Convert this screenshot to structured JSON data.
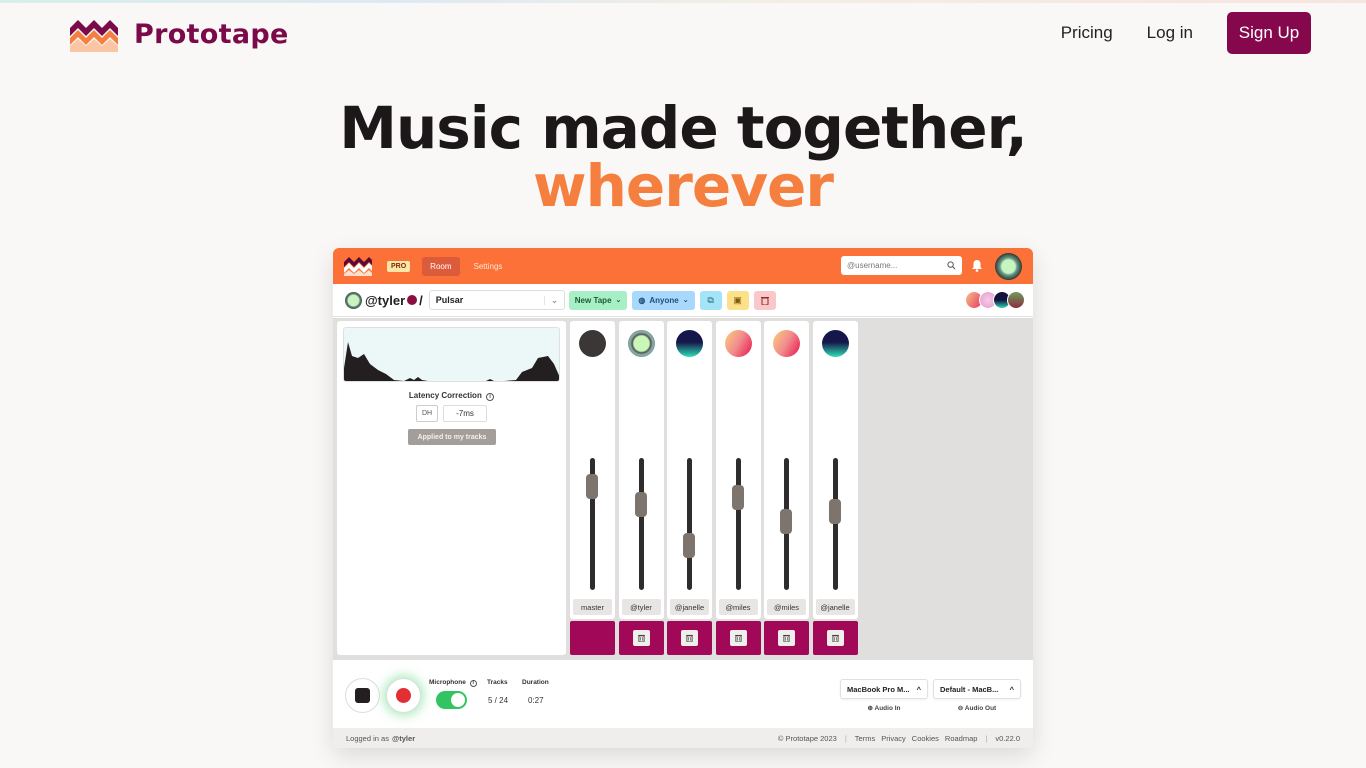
{
  "header": {
    "brand_name": "Prototape",
    "nav": {
      "pricing": "Pricing",
      "login": "Log in",
      "signup": "Sign Up"
    },
    "colors": {
      "brand": "#7a0a4a",
      "signup_bg": "#85084c",
      "accent": "#f57f3f"
    }
  },
  "hero": {
    "line1": "Music made together,",
    "line2": "wherever"
  },
  "app": {
    "topbar": {
      "badge": "PRO",
      "tabs": [
        {
          "label": "Room",
          "active": true
        },
        {
          "label": "Settings",
          "active": false
        }
      ],
      "search_placeholder": "@username...",
      "search_icon": "search-icon",
      "bell_icon": "bell-icon"
    },
    "toolbar": {
      "user": "@tyler",
      "separator": "/",
      "tape_name": "Pulsar",
      "new_tape": "New Tape",
      "visibility": "Anyone",
      "icons": [
        "copy-icon",
        "folder-play-icon",
        "trash-icon"
      ]
    },
    "latency": {
      "label": "Latency Correction",
      "skip_label": "DH",
      "value": "-7ms",
      "applied_label": "Applied to my tracks"
    },
    "channels": [
      {
        "label": "master",
        "fader": 0.85,
        "avatar": "dark",
        "deletable": false
      },
      {
        "label": "@tyler",
        "fader": 0.68,
        "avatar": "green-ring",
        "deletable": true
      },
      {
        "label": "@janelle",
        "fader": 0.3,
        "avatar": "night",
        "deletable": true
      },
      {
        "label": "@miles",
        "fader": 0.75,
        "avatar": "sunset",
        "deletable": true
      },
      {
        "label": "@miles",
        "fader": 0.52,
        "avatar": "sunset",
        "deletable": true
      },
      {
        "label": "@janelle",
        "fader": 0.62,
        "avatar": "night",
        "deletable": true
      }
    ],
    "bottombar": {
      "microphone_label": "Microphone",
      "microphone_on": true,
      "tracks_label": "Tracks",
      "tracks_value": "5 / 24",
      "duration_label": "Duration",
      "duration_value": "0:27",
      "audio_in_device": "MacBook Pro M...",
      "audio_in_label": "Audio In",
      "audio_out_device": "Default - MacB...",
      "audio_out_label": "Audio Out"
    },
    "footer": {
      "logged_in_prefix": "Logged in as",
      "logged_in_user": "@tyler",
      "copyright": "© Prototape 2023",
      "links": [
        "Terms",
        "Privacy",
        "Cookies",
        "Roadmap"
      ],
      "version": "v0.22.0"
    }
  }
}
